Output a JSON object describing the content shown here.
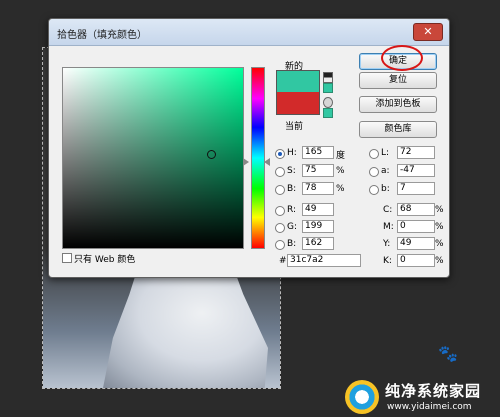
{
  "dialog": {
    "title": "拾色器（填充颜色）",
    "close_glyph": "✕",
    "new_label": "新的",
    "current_label": "当前",
    "new_color": "#31c7a2",
    "current_color": "#d22a2a"
  },
  "buttons": {
    "ok": "确定",
    "reset": "复位",
    "add_to_swatches": "添加到色板",
    "color_libraries": "颜色库"
  },
  "hsb": {
    "h": {
      "label": "H:",
      "value": "165",
      "unit": "度"
    },
    "s": {
      "label": "S:",
      "value": "75",
      "unit": "%"
    },
    "b": {
      "label": "B:",
      "value": "78",
      "unit": "%"
    }
  },
  "rgb": {
    "r": {
      "label": "R:",
      "value": "49"
    },
    "g": {
      "label": "G:",
      "value": "199"
    },
    "b": {
      "label": "B:",
      "value": "162"
    }
  },
  "lab": {
    "l": {
      "label": "L:",
      "value": "72"
    },
    "a": {
      "label": "a:",
      "value": "-47"
    },
    "b": {
      "label": "b:",
      "value": "7"
    }
  },
  "cmyk": {
    "c": {
      "label": "C:",
      "value": "68",
      "unit": "%"
    },
    "m": {
      "label": "M:",
      "value": "0",
      "unit": "%"
    },
    "y": {
      "label": "Y:",
      "value": "49",
      "unit": "%"
    },
    "k": {
      "label": "K:",
      "value": "0",
      "unit": "%"
    }
  },
  "hex": {
    "label": "#",
    "value": "31c7a2"
  },
  "web_only_label": "只有 Web 颜色",
  "watermark": {
    "title": "纯净系统家园",
    "url": "www.yidaimei.com"
  },
  "paw_glyph": "🐾"
}
